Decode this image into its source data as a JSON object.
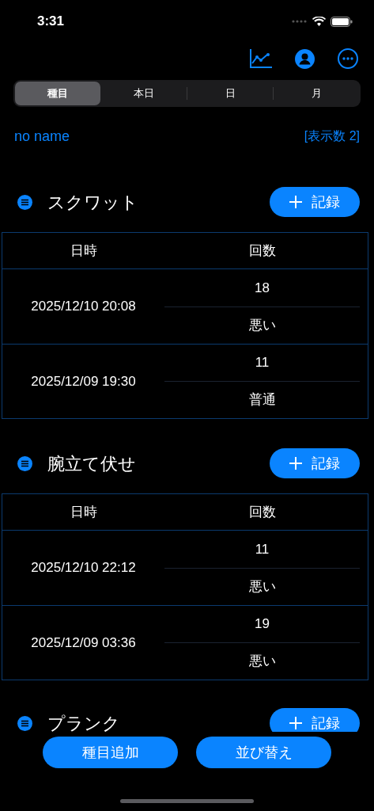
{
  "status_bar": {
    "time": "3:31"
  },
  "segments": [
    {
      "label": "種目",
      "selected": true
    },
    {
      "label": "本日",
      "selected": false
    },
    {
      "label": "日",
      "selected": false
    },
    {
      "label": "月",
      "selected": false
    }
  ],
  "user_name": "no name",
  "display_count": "[表示数 2]",
  "sections": [
    {
      "name": "スクワット",
      "record_button": "記録",
      "columns": [
        "日時",
        "回数"
      ],
      "rows": [
        {
          "datetime": "2025/12/10 20:08",
          "count": "18",
          "rating": "悪い"
        },
        {
          "datetime": "2025/12/09 19:30",
          "count": "11",
          "rating": "普通"
        }
      ]
    },
    {
      "name": "腕立て伏せ",
      "record_button": "記録",
      "columns": [
        "日時",
        "回数"
      ],
      "rows": [
        {
          "datetime": "2025/12/10 22:12",
          "count": "11",
          "rating": "悪い"
        },
        {
          "datetime": "2025/12/09 03:36",
          "count": "19",
          "rating": "悪い"
        }
      ]
    },
    {
      "name": "プランク",
      "record_button": "記録"
    }
  ],
  "bottom_buttons": [
    "種目追加",
    "並び替え"
  ]
}
